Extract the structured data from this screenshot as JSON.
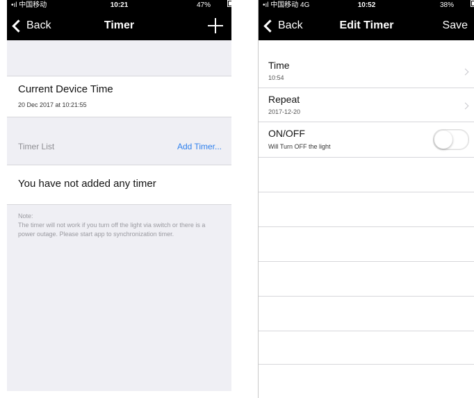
{
  "left": {
    "status": {
      "carrier": "•ıl 中国移动",
      "time": "10:21",
      "battery": "47%",
      "battery_fill": 0.47
    },
    "nav": {
      "back": "Back",
      "title": "Timer"
    },
    "device_time": {
      "label": "Current Device Time",
      "value": "20 Dec 2017 at 10:21:55"
    },
    "timer_list": {
      "label": "Timer List",
      "add": "Add Timer..."
    },
    "empty": "You have not added any timer",
    "note": {
      "title": "Note:",
      "body": "The timer will not work if you turn off the light via switch or there is a power outage. Please start app to synchronization timer."
    }
  },
  "right": {
    "status": {
      "carrier": "•ıl 中国移动  4G",
      "time": "10:52",
      "battery": "38%",
      "battery_fill": 0.38
    },
    "nav": {
      "back": "Back",
      "title": "Edit Timer",
      "save": "Save"
    },
    "rows": [
      {
        "title": "Time",
        "subtitle": "10:54"
      },
      {
        "title": "Repeat",
        "subtitle": "2017-12-20"
      },
      {
        "title": "ON/OFF",
        "subtitle": "Will Turn OFF the light"
      }
    ],
    "toggle_on": false
  }
}
